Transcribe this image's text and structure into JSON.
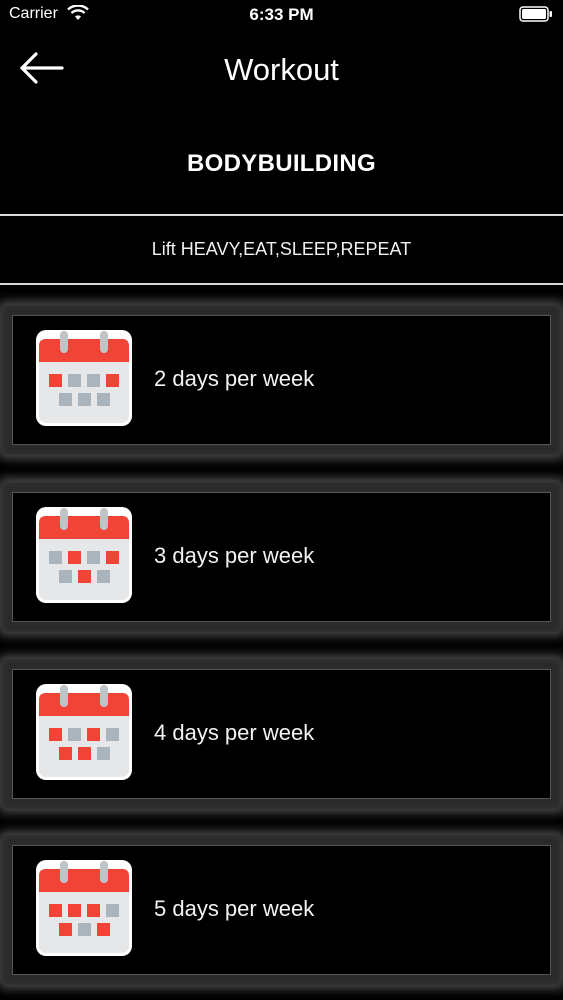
{
  "status_bar": {
    "carrier": "Carrier",
    "time": "6:33 PM"
  },
  "nav": {
    "title": "Workout",
    "back_icon": "arrow-left-icon"
  },
  "program": {
    "title": "BODYBUILDING",
    "tagline": "Lift HEAVY,EAT,SLEEP,REPEAT"
  },
  "plans": [
    {
      "label": "2 days per week",
      "icon": "calendar-icon",
      "active_days": [
        0,
        3
      ]
    },
    {
      "label": "3 days per week",
      "icon": "calendar-icon",
      "active_days": [
        1,
        3,
        5
      ]
    },
    {
      "label": "4 days per week",
      "icon": "calendar-icon",
      "active_days": [
        0,
        2,
        4,
        5
      ]
    },
    {
      "label": "5 days per week",
      "icon": "calendar-icon",
      "active_days": [
        0,
        1,
        2,
        4,
        6
      ]
    }
  ],
  "colors": {
    "background": "#000000",
    "calendar_header": "#f04437",
    "calendar_body": "#e6e7e8",
    "day_off": "#aab4bd",
    "day_on": "#f04437"
  }
}
